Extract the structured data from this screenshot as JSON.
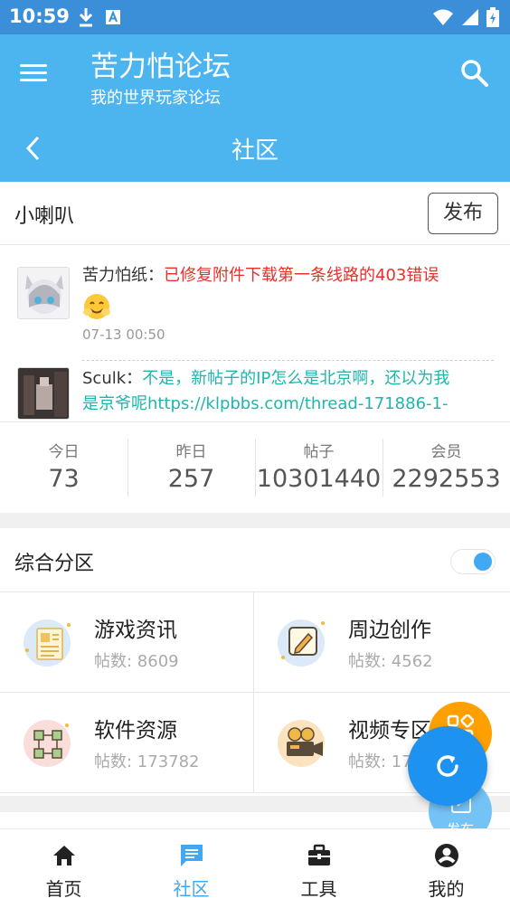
{
  "status_bar": {
    "time": "10:59"
  },
  "app_bar": {
    "title": "苦力怕论坛",
    "subtitle": "我的世界玩家论坛"
  },
  "sub_bar": {
    "title": "社区"
  },
  "loudspeaker": {
    "title": "小喇叭",
    "post_button": "发布",
    "items": [
      {
        "author": "苦力怕纸：",
        "message": "已修复附件下载第一条线路的403错误",
        "time": "07-13 00:50"
      },
      {
        "author": "Sculk：",
        "message": "不是，新帖子的IP怎么是北京啊，还以为我是京爷呢https://klpbbs.com/thread-171886-1-"
      }
    ]
  },
  "stats": [
    {
      "label": "今日",
      "value": "73"
    },
    {
      "label": "昨日",
      "value": "257"
    },
    {
      "label": "帖子",
      "value": "10301440"
    },
    {
      "label": "会员",
      "value": "2292553"
    }
  ],
  "section": {
    "title": "综合分区",
    "toggle_on": true,
    "forums": [
      {
        "name": "游戏资讯",
        "count_label": "帖数: 8609",
        "icon": "news-icon"
      },
      {
        "name": "周边创作",
        "count_label": "帖数: 4562",
        "icon": "pencil-icon"
      },
      {
        "name": "软件资源",
        "count_label": "帖数: 173782",
        "icon": "network-icon"
      },
      {
        "name": "视频专区",
        "count_label": "帖数: 17",
        "icon": "camera-icon"
      }
    ]
  },
  "fab": {
    "post_label": "发布"
  },
  "bottom_nav": [
    {
      "label": "首页",
      "icon": "home-icon"
    },
    {
      "label": "社区",
      "icon": "chat-icon",
      "active": true
    },
    {
      "label": "工具",
      "icon": "toolbox-icon"
    },
    {
      "label": "我的",
      "icon": "account-icon"
    }
  ],
  "colors": {
    "primary": "#4cb4ef",
    "status_bar": "#3a8fd8",
    "accent": "#41a9f3",
    "fab_orange": "#ffa000",
    "fab_blue": "#1e92f0",
    "red_text": "#e8302a",
    "teal_text": "#1fb5ad"
  }
}
